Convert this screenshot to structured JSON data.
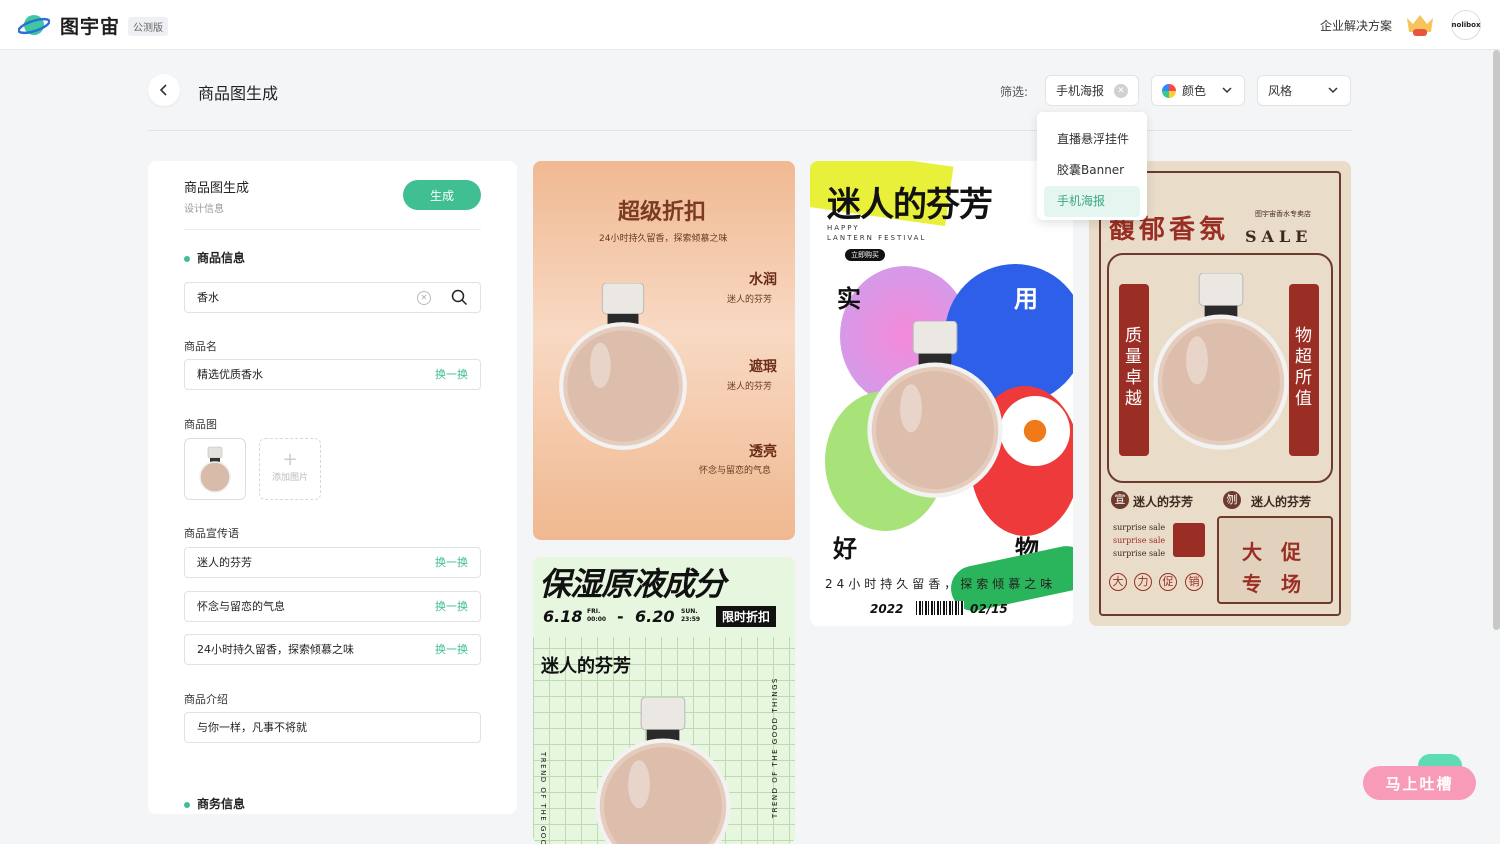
{
  "header": {
    "logo_text": "图宇宙",
    "beta": "公测版",
    "enterprise": "企业解决方案",
    "avatar": "nolibox"
  },
  "page": {
    "title": "商品图生成"
  },
  "filters": {
    "label": "筛选:",
    "chip1": "手机海报",
    "chip2": "颜色",
    "chip3": "风格",
    "options": [
      "直播悬浮挂件",
      "胶囊Banner",
      "手机海报"
    ]
  },
  "panel": {
    "title": "商品图生成",
    "subtitle": "设计信息",
    "generate": "生成",
    "section_product": "商品信息",
    "search_value": "香水",
    "name_label": "商品名",
    "name_value": "精选优质香水",
    "swap": "换一换",
    "image_label": "商品图",
    "add_image": "添加图片",
    "slogan_label": "商品宣传语",
    "slogans": [
      "迷人的芬芳",
      "怀念与留恋的气息",
      "24小时持久留香，探索倾慕之味"
    ],
    "intro_label": "商品介绍",
    "intro_value": "与你一样，凡事不将就",
    "section_business": "商务信息"
  },
  "card1": {
    "title": "超级折扣",
    "sub": "24小时持久留香，探索倾慕之味",
    "f1": "水润",
    "f1s": "迷人的芬芳",
    "f2": "遮瑕",
    "f2s": "迷人的芬芳",
    "f3": "透亮",
    "f3s": "怀念与留恋的气息"
  },
  "card2": {
    "title": "迷人的芬芳",
    "en1": "HAPPY",
    "en2": "LANTERN FESTIVAL",
    "badge": "立即购买",
    "c1": "实",
    "c2": "用",
    "c3": "好",
    "c4": "物",
    "slogan": "24小时持久留香，探索倾慕之味",
    "year": "2022",
    "date": "02/15"
  },
  "card3": {
    "title": "馥郁香氛",
    "shop": "图宇宙香水专卖店",
    "sale": "SALE",
    "left": "质量卓越",
    "right": "物超所值",
    "mark1": "宣",
    "mark2": "刎",
    "t1": "迷人的芬芳",
    "t2": "迷人的芬芳",
    "en": [
      "surprise sale",
      "surprise sale",
      "surprise sale"
    ],
    "big": [
      "大",
      "促",
      "专",
      "场"
    ],
    "small": [
      "大",
      "力",
      "促",
      "销"
    ]
  },
  "card4": {
    "title": "保湿原液成分",
    "d1": "6.18",
    "d1a": "FRI.",
    "d1b": "00:00",
    "dash": "-",
    "d2": "6.20",
    "d2a": "SUN.",
    "d2b": "23:59",
    "tag": "限时折扣",
    "sub": "迷人的芬芳",
    "side1": "TREND OF THE GOOD THINGS",
    "side2": "TREND OF THE GOO"
  },
  "feedback": "马上吐槽"
}
